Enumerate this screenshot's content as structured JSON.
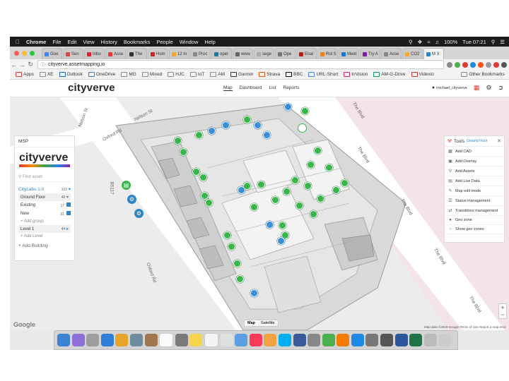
{
  "menubar": {
    "app": "Chrome",
    "items": [
      "File",
      "Edit",
      "View",
      "History",
      "Bookmarks",
      "People",
      "Window",
      "Help"
    ],
    "battery": "100%",
    "clock": "Tue 07:21"
  },
  "tabs": [
    {
      "label": "Goo"
    },
    {
      "label": "Sen"
    },
    {
      "label": "Inbo"
    },
    {
      "label": "Asse"
    },
    {
      "label": "The"
    },
    {
      "label": "Hom"
    },
    {
      "label": "12 in"
    },
    {
      "label": "Proc"
    },
    {
      "label": "opet"
    },
    {
      "label": "www"
    },
    {
      "label": "sege"
    },
    {
      "label": "Ope"
    },
    {
      "label": "Enal"
    },
    {
      "label": "Rol S"
    },
    {
      "label": "Meet"
    },
    {
      "label": "Try A"
    },
    {
      "label": "Asse"
    },
    {
      "label": "CO2"
    },
    {
      "label": "M X"
    }
  ],
  "address": {
    "url": "cityverve.assetmapping.io"
  },
  "bookmarks": [
    "Apps",
    "XE",
    "Outlook",
    "OneDrive",
    "MG",
    "Mixed",
    "HJC",
    "IoT",
    "AM",
    "Garmin",
    "Strava",
    "BBC",
    "URL-Short",
    "InVision",
    "AM-G-Drive",
    "Videxio"
  ],
  "bookmarks_other": "Other Bookmarks",
  "header": {
    "logo": "cityverve",
    "nav": [
      "Map",
      "Dashboard",
      "List",
      "Reports"
    ],
    "user": "michael_cityverve"
  },
  "left_panel": {
    "title": "MSP",
    "logo": "cityverve",
    "find_placeholder": "Find asset",
    "site": {
      "name": "CityLabs 1.0",
      "count": "103"
    },
    "floor": {
      "name": "Ground Floor",
      "count": "48"
    },
    "groups": [
      {
        "name": "Existing",
        "count": "17"
      },
      {
        "name": "New",
        "count": "31"
      }
    ],
    "add_group": "Add group",
    "level": {
      "name": "Level 1",
      "count": "44"
    },
    "add_level": "Add Level",
    "add_building": "Add Building"
  },
  "tools": {
    "title": "Tools",
    "subtitle": "Ground Floor",
    "items": [
      {
        "label": "Add CAD",
        "icon": "cad-icon"
      },
      {
        "label": "Add Overlay",
        "icon": "image-icon"
      },
      {
        "label": "Add Assets",
        "icon": "asset-icon"
      },
      {
        "label": "Add Live Data",
        "icon": "data-icon"
      },
      {
        "label": "Map edit mode",
        "icon": "edit-icon"
      },
      {
        "label": "Status management",
        "icon": "status-icon"
      },
      {
        "label": "Transitions management",
        "icon": "transitions-icon"
      },
      {
        "label": "Geo zone",
        "icon": "geozone-icon"
      },
      {
        "label": "Show geo zones",
        "icon": "geozones-icon"
      }
    ]
  },
  "map": {
    "streets": [
      "Nelson St",
      "Nelson St",
      "Oxford Rd",
      "B5117",
      "Oxford Rd",
      "The Blvd",
      "The Blvd",
      "The Blvd",
      "The Blvd",
      "The Blvd"
    ],
    "type_buttons": [
      "Map",
      "Satellite"
    ],
    "footer": "Map data ©2016 Google   Terms of Use   Report a map error",
    "watermark": "Google",
    "zoom_in": "+",
    "zoom_out": "−"
  },
  "colors": {
    "accent": "#2c84c9",
    "marker_green": "#3ab54a",
    "marker_blue": "#3b8fd6"
  }
}
